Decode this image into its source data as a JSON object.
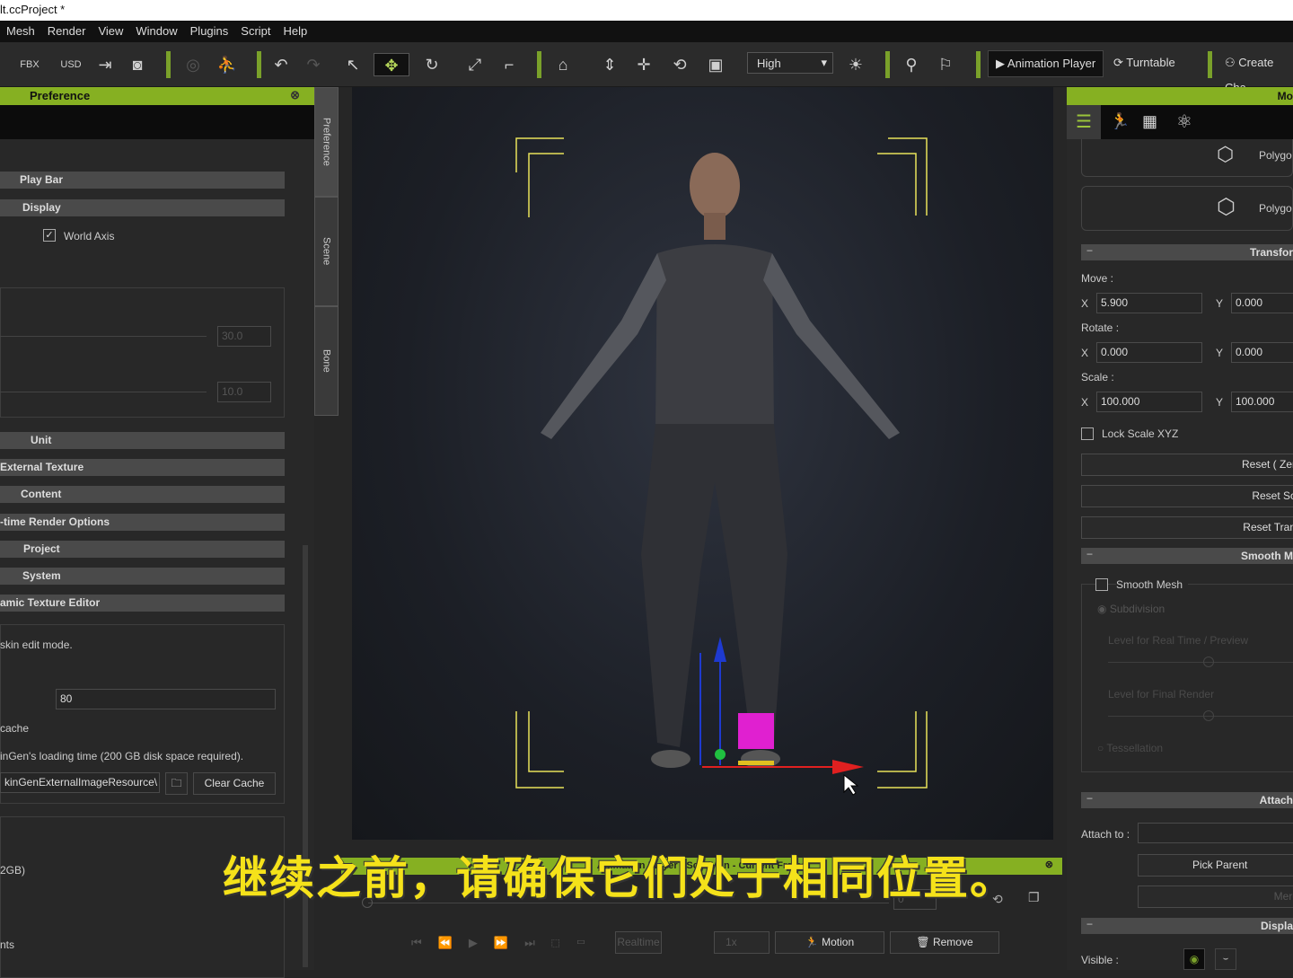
{
  "title": "lt.ccProject *",
  "menu": [
    "Mesh",
    "Render",
    "View",
    "Window",
    "Plugins",
    "Script",
    "Help"
  ],
  "toolbar": {
    "quality": "High",
    "animation_player": "Animation Player",
    "turntable": "Turntable",
    "create_character": "Create Cha"
  },
  "left_panel": {
    "title": "Preference",
    "sections": [
      "Play Bar",
      "Display",
      "Unit",
      "External Texture",
      "Content",
      "-time Render Options",
      "Project",
      "System",
      "amic Texture Editor"
    ],
    "world_axis": "World Axis",
    "spin1": "30.0",
    "spin2": "10.0",
    "skin_edit": "skin edit mode.",
    "cache_value": "80",
    "cache_label": "cache",
    "loading_note": "inGen's loading time (200 GB disk space required).",
    "path": "kinGenExternalImageResource\\",
    "clear_cache": "Clear Cache",
    "gb": "2GB)",
    "nts": "nts"
  },
  "side_tabs": [
    "Preference",
    "Scene",
    "Bone"
  ],
  "right_panel": {
    "title": "Mo",
    "polygon1": "Polygo",
    "polygon2": "Polygo",
    "transform": "Transfor",
    "move": "Move :",
    "rotate": "Rotate :",
    "scale": "Scale :",
    "x": "X",
    "y": "Y",
    "move_x": "5.900",
    "move_y": "0.000",
    "rotate_x": "0.000",
    "rotate_y": "0.000",
    "scale_x": "100.000",
    "scale_y": "100.000",
    "lock_scale": "Lock Scale XYZ",
    "reset_zero": "Reset ( Zer",
    "reset_scale": "Reset Sc",
    "reset_trans": "Reset Tran",
    "smooth_head": "Smooth M",
    "smooth_mesh": "Smooth Mesh",
    "subdivision": "Subdivision",
    "level_rt": "Level for Real Time / Preview",
    "level_final": "Level for Final Render",
    "tessellation": "Tessellation",
    "attach_head": "Attach",
    "attach_to": "Attach to :",
    "pick_parent": "Pick Parent",
    "merge": "Merg",
    "display_head": "Displa",
    "visible": "Visible :"
  },
  "anim": {
    "title": "Animation Player : ScanMan - Current Frame",
    "frame": "0",
    "realtime": "Realtime",
    "speed": "1x",
    "motion": "Motion",
    "remove": "Remove"
  },
  "subtitle": "继续之前，请确保它们处于相同位置。"
}
